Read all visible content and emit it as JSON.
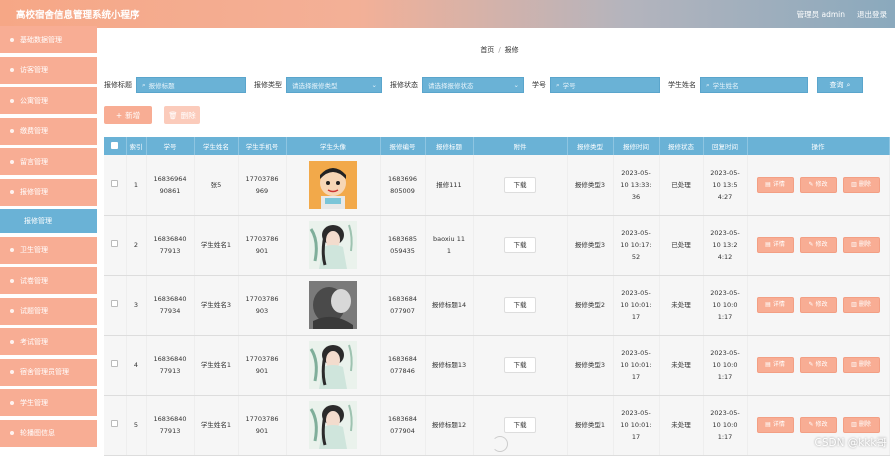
{
  "header": {
    "title": "高校宿舍信息管理系统小程序",
    "user": "管理员 admin",
    "logout": "退出登录"
  },
  "sidebar": {
    "items": [
      {
        "label": "基础数据管理"
      },
      {
        "label": "访客管理"
      },
      {
        "label": "公寓管理"
      },
      {
        "label": "缴费管理"
      },
      {
        "label": "留言管理"
      },
      {
        "label": "报修管理"
      },
      {
        "label": "报修管理",
        "sub": true
      },
      {
        "label": "卫生管理"
      },
      {
        "label": "试卷管理"
      },
      {
        "label": "试题管理"
      },
      {
        "label": "考试管理"
      },
      {
        "label": "宿舍管理员管理"
      },
      {
        "label": "学生管理"
      },
      {
        "label": "轮播图信息"
      }
    ]
  },
  "breadcrumb": {
    "home": "首页",
    "sep": "/",
    "current": "报修"
  },
  "filters": {
    "title_label": "报修标题",
    "title_placeholder": "报修标题",
    "type_label": "报修类型",
    "type_placeholder": "请选择报修类型",
    "status_label": "报修状态",
    "status_placeholder": "请选择报修状态",
    "student_no_label": "学号",
    "student_no_placeholder": "学号",
    "student_name_label": "学生姓名",
    "student_name_placeholder": "学生姓名",
    "query_label": "查询"
  },
  "actions": {
    "add": "新增",
    "delete": "删除"
  },
  "table": {
    "headers": [
      "",
      "索引",
      "学号",
      "学生姓名",
      "学生手机号",
      "学生头像",
      "报修编号",
      "报修标题",
      "附件",
      "报修类型",
      "报修时间",
      "报修状态",
      "回复时间",
      "操作"
    ],
    "download_label": "下载",
    "op_labels": {
      "detail": "详情",
      "edit": "修改",
      "delete": "删除"
    },
    "rows": [
      {
        "idx": "1",
        "student_no": "16836964​90861",
        "name": "张5",
        "phone": "17703786969",
        "avatar": "cartoon",
        "repair_no": "16836968​05009",
        "title": "报修111",
        "type": "报修类型3",
        "time": "2023-05-10 13:33:36",
        "status": "已处理",
        "reply": "2023-05-10 13:54:27"
      },
      {
        "idx": "2",
        "student_no": "16836840​77913",
        "name": "学生姓名1",
        "phone": "17703786901",
        "avatar": "girl",
        "repair_no": "16836850​59435",
        "title": "baoxiu 111",
        "type": "报修类型3",
        "time": "2023-05-10 10:17:52",
        "status": "已处理",
        "reply": "2023-05-10 13:24:12"
      },
      {
        "idx": "3",
        "student_no": "16836840​77934",
        "name": "学生姓名3",
        "phone": "17703786903",
        "avatar": "dark",
        "repair_no": "16836840​77907",
        "title": "报修标题14",
        "type": "报修类型2",
        "time": "2023-05-10 10:01:17",
        "status": "未处理",
        "reply": "2023-05-10 10:01:17"
      },
      {
        "idx": "4",
        "student_no": "16836840​77913",
        "name": "学生姓名1",
        "phone": "17703786901",
        "avatar": "girl",
        "repair_no": "16836840​77846",
        "title": "报修标题13",
        "type": "报修类型3",
        "time": "2023-05-10 10:01:17",
        "status": "未处理",
        "reply": "2023-05-10 10:01:17"
      },
      {
        "idx": "5",
        "student_no": "16836840​77913",
        "name": "学生姓名1",
        "phone": "17703786901",
        "avatar": "girl",
        "repair_no": "16836840​77904",
        "title": "报修标题12",
        "type": "报修类型1",
        "time": "2023-05-10 10:01:17",
        "status": "未处理",
        "reply": "2023-05-10 10:01:17"
      }
    ]
  },
  "watermark": "CSDN @kkk哥"
}
